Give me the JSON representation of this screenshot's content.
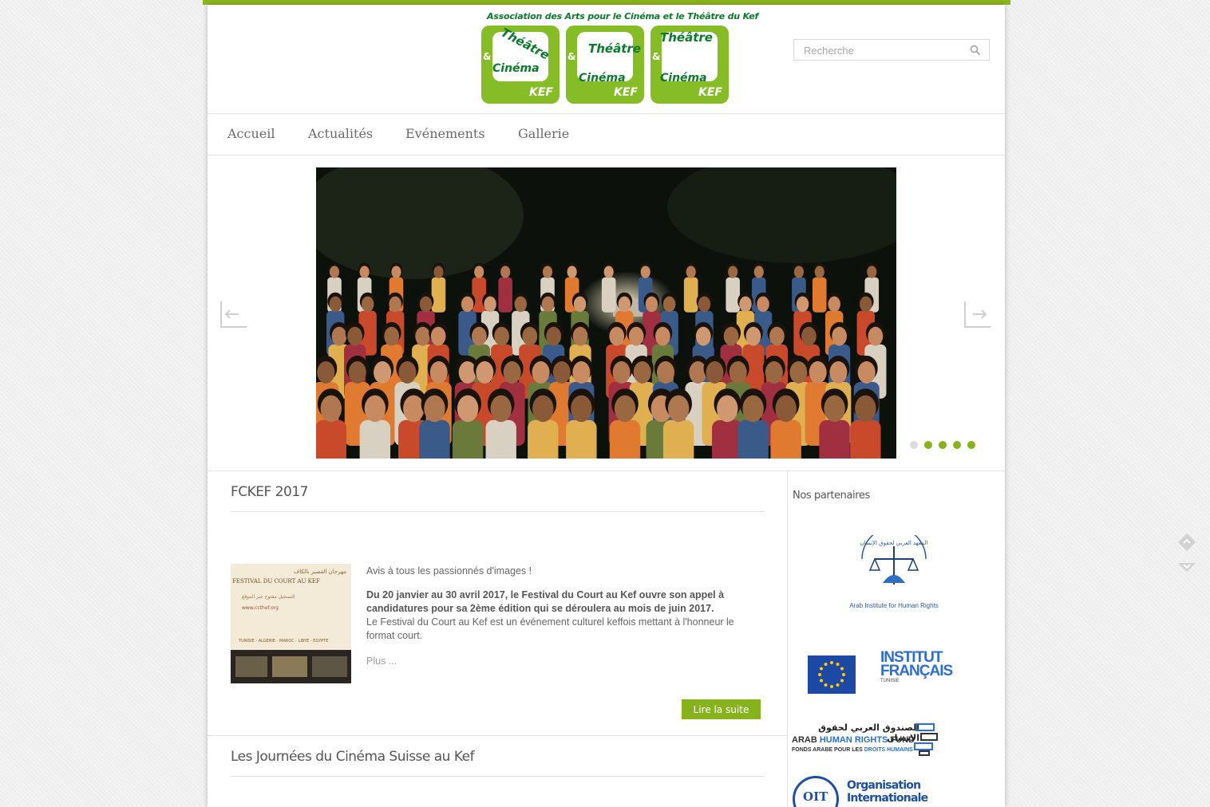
{
  "header": {
    "association_name": "Association des Arts pour le Cinéma et le Théâtre du Kef",
    "logo_tiles": [
      {
        "word1": "Théâtre",
        "amp": "&",
        "word2": "Cinéma",
        "kef": "KEF"
      },
      {
        "word1": "Théâtre",
        "amp": "&",
        "word2": "Cinéma",
        "kef": "KEF"
      },
      {
        "word1": "Théâtre",
        "amp": "&",
        "word2": "Cinéma",
        "kef": "KEF"
      }
    ]
  },
  "search": {
    "placeholder": "Recherche",
    "icon": "search-icon"
  },
  "nav": {
    "items": [
      {
        "label": "Accueil"
      },
      {
        "label": "Actualités"
      },
      {
        "label": "Evénements"
      },
      {
        "label": "Gallerie"
      }
    ]
  },
  "slider": {
    "slide_count": 5,
    "active_index": 0,
    "colors": {
      "active": "#dcdcdc",
      "inactive": "#86b31b"
    }
  },
  "articles": [
    {
      "title": "FCKEF 2017",
      "intro": "Avis à tous les passionnés d'images !",
      "bold": "Du 20 janvier au 30 avril 2017, le Festival du Court au Kef ouvre son appel à candidatures pour sa 2ème édition qui se déroulera au mois de juin 2017.",
      "body": "Le Festival du Court au Kef est un événement culturel keffois mettant à l'honneur le format court.",
      "more": "Plus ...",
      "read_more": "Lire la suite",
      "thumb": {
        "arabic_title": "مهرجان القصير بالكاف",
        "latin_title": "FESTIVAL DU COURT AU KEF",
        "line1": "التسجيل مفتوح عبر الموقع",
        "site": "www.ccthef.org",
        "countries": "TUNISIE - ALGERIE - MAROC - LIBYE - EGYPTE"
      }
    },
    {
      "title": "Les Journées du Cinéma Suisse au Kef"
    }
  ],
  "sidebar": {
    "title": "Nos partenaires",
    "partners": [
      {
        "name": "Arab Institute for Human Rights",
        "arabic": "المعهد العربي لحقوق الإنسان"
      },
      {
        "name": "European Union"
      },
      {
        "name": "INSTITUT FRANÇAIS",
        "sub": "TUNISIE"
      },
      {
        "arabic": "الصندوق العربي لحقوق الانسان",
        "name_a": "ARAB",
        "name_b": "HUMAN RIGHTS",
        "name_c": "FUND",
        "sub_a": "FONDS ARABE POUR LES ",
        "sub_b": "DROITS HUMAINS"
      },
      {
        "abbr": "OIT",
        "line1": "Organisation",
        "line2": "Internationale"
      }
    ]
  },
  "colors": {
    "brand_green": "#86b31b",
    "dark_green": "#0b7a2a"
  }
}
